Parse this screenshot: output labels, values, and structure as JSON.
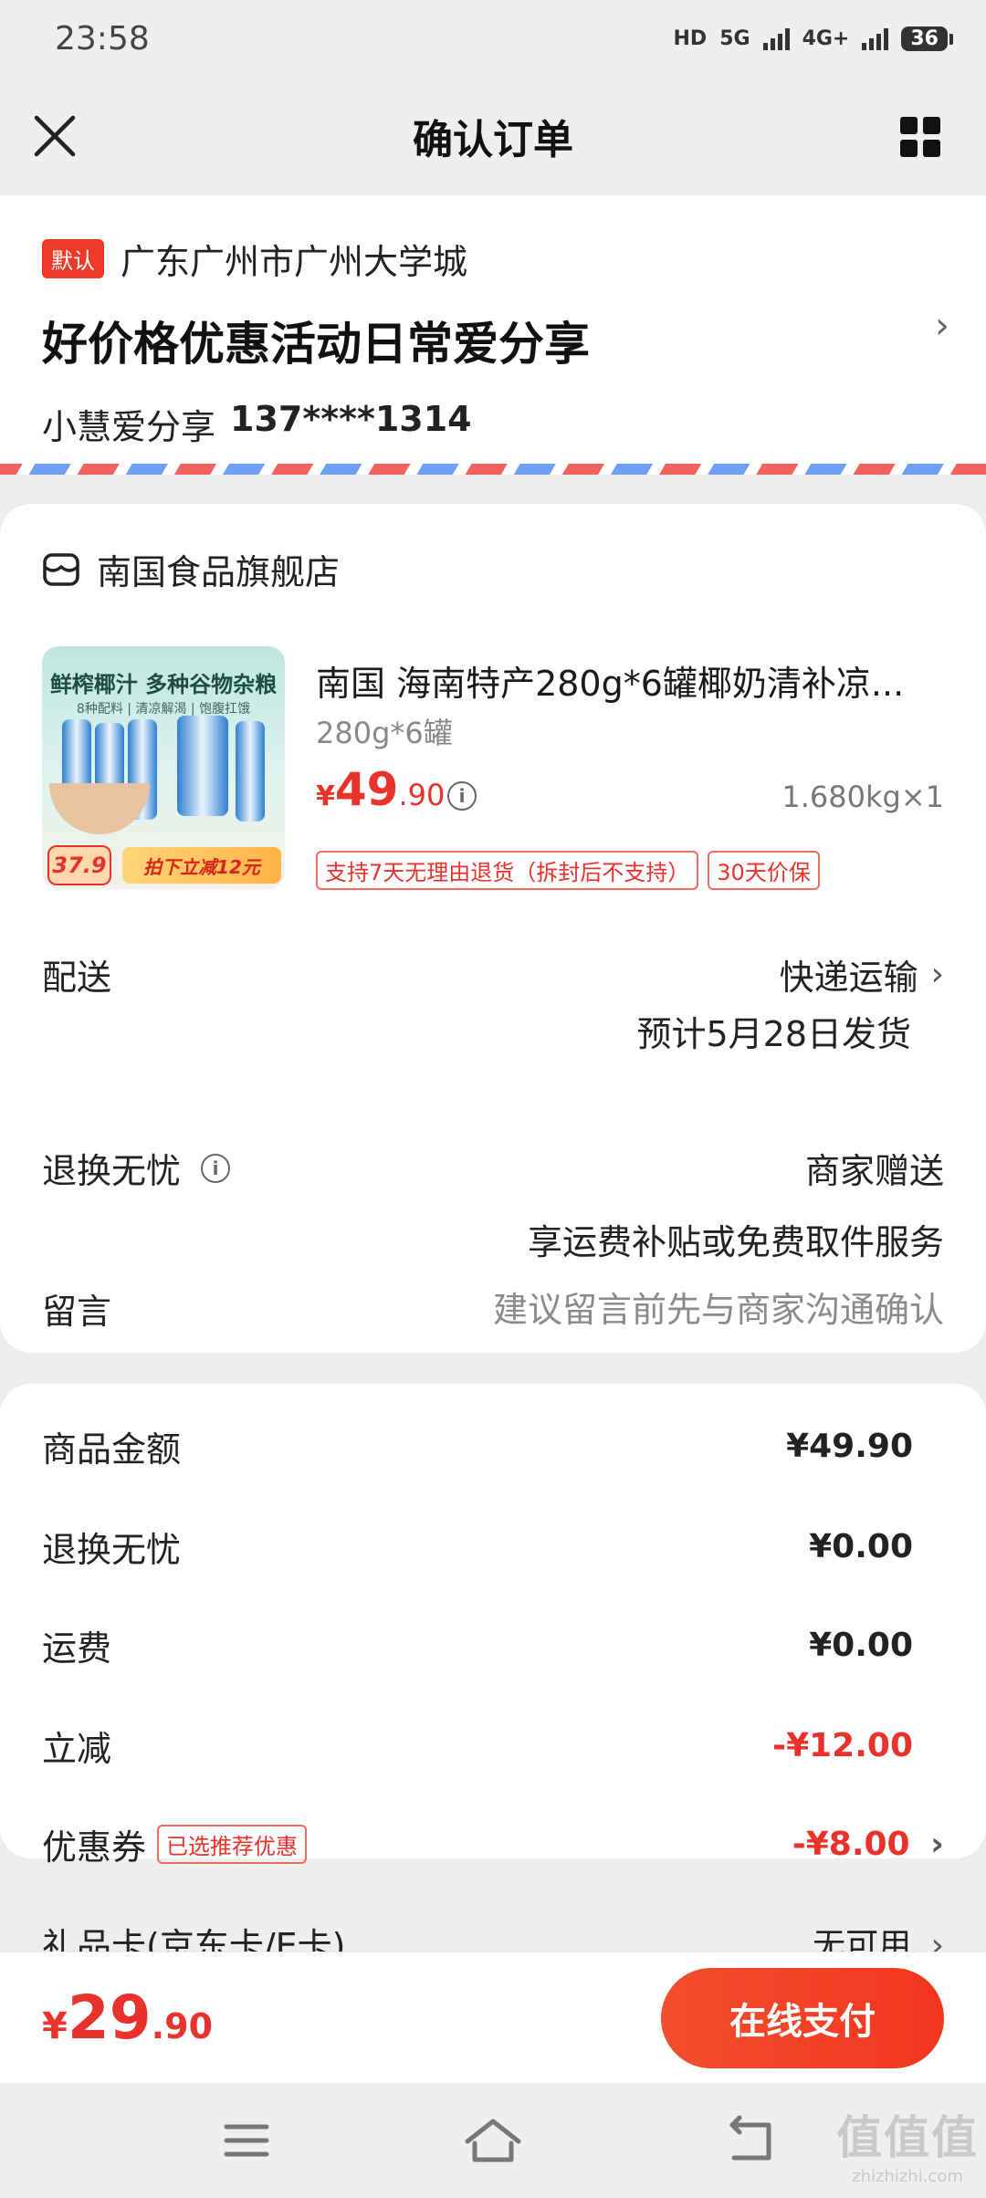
{
  "status_bar": {
    "time": "23:58",
    "hd": "HD",
    "net1": "5G",
    "net2": "4G+",
    "battery": "36"
  },
  "nav": {
    "title": "确认订单"
  },
  "address": {
    "default_badge": "默认",
    "region": "广东广州市广州大学城",
    "detail": "好价格优惠活动日常爱分享",
    "name": "小慧爱分享",
    "phone": "137****1314"
  },
  "store": {
    "name": "南国食品旗舰店"
  },
  "product": {
    "title": "南国 海南特产280g*6罐椰奶清补凉...",
    "spec": "280g*6罐",
    "price_symbol": "¥",
    "price_int": "49",
    "price_dec": ".90",
    "weight": "1.680kg×1",
    "tags": [
      "支持7天无理由退货（拆封后不支持）",
      "30天价保"
    ],
    "thumb": {
      "slogan": "鲜榨椰汁  多种谷物杂粮",
      "sub": "8种配料 | 清凉解渴 | 饱腹扛饿",
      "price": "37.9",
      "cut": "拍下立减12元"
    }
  },
  "delivery": {
    "label": "配送",
    "method": "快递运输",
    "estimate": "预计5月28日发货"
  },
  "return": {
    "label": "退换无忧",
    "value": "商家赠送",
    "desc": "享运费补贴或免费取件服务"
  },
  "message": {
    "label": "留言",
    "placeholder": "建议留言前先与商家沟通确认"
  },
  "details": {
    "goods_amount": {
      "label": "商品金额",
      "value": "¥49.90"
    },
    "return_fee": {
      "label": "退换无忧",
      "value": "¥0.00"
    },
    "shipping": {
      "label": "运费",
      "value": "¥0.00"
    },
    "discount": {
      "label": "立减",
      "value": "-¥12.00"
    },
    "coupon": {
      "label": "优惠券",
      "tag": "已选推荐优惠",
      "value": "-¥8.00"
    },
    "gift_card": {
      "label": "礼品卡(京东卡/E卡)",
      "value": "无可用"
    }
  },
  "pay": {
    "symbol": "¥",
    "int": "29",
    "dec": ".90",
    "button": "在线支付"
  },
  "watermark": {
    "big": "值值值",
    "small": "zhizhizhi.com"
  },
  "colors": {
    "accent": "#e9322b",
    "button": "#f2361f",
    "background": "#eeeeee"
  }
}
